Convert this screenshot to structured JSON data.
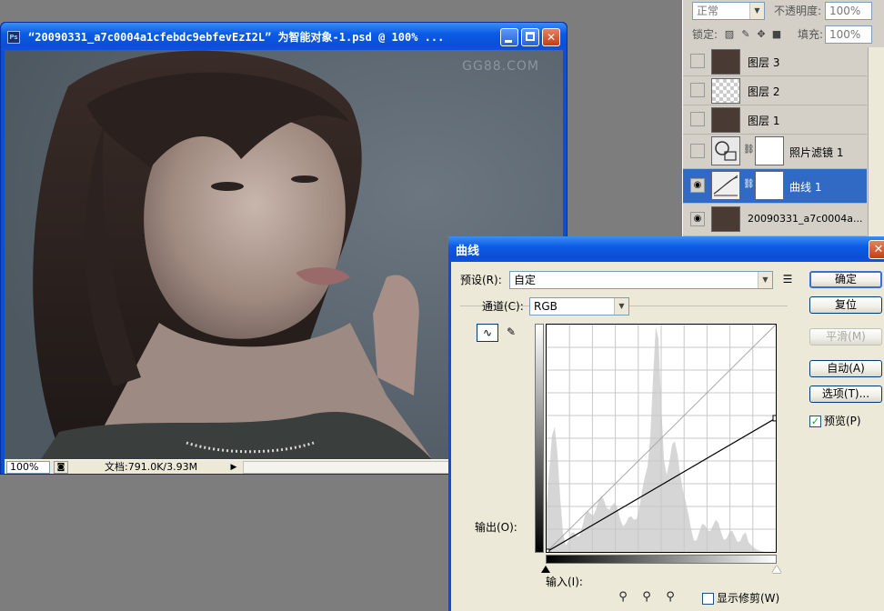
{
  "document": {
    "title": "“20090331_a7c0004a1cfebdc9ebfevEzI2L” 为智能对象-1.psd @ 100% ...",
    "app_icon": "Ps",
    "minimize_icon": "minimize-icon",
    "maximize_icon": "maximize-icon",
    "close_glyph": "✕",
    "watermark": "GG88.COM",
    "zoom": "100%",
    "doc_info": "文档:791.0K/3.93M",
    "status_menu_glyph": "◙",
    "status_arrow_glyph": "▶"
  },
  "layers_panel": {
    "blend_mode": "正常",
    "opacity_label": "不透明度:",
    "opacity_value": "100%",
    "lock_label": "锁定:",
    "fill_label": "填充:",
    "fill_value": "100%",
    "layers": [
      {
        "name": "图层 3",
        "visible": false,
        "selected": false
      },
      {
        "name": "图层 2",
        "visible": false,
        "selected": false
      },
      {
        "name": "图层 1",
        "visible": false,
        "selected": false
      },
      {
        "name": "照片滤镜 1",
        "visible": false,
        "selected": false
      },
      {
        "name": "曲线 1",
        "visible": true,
        "selected": true
      },
      {
        "name": "20090331_a7c0004a...",
        "visible": true,
        "selected": false
      }
    ]
  },
  "curves_dialog": {
    "title": "曲线",
    "close_glyph": "✕",
    "preset_label": "预设(R):",
    "preset_value": "自定",
    "channel_label": "通道(C):",
    "channel_value": "RGB",
    "output_label": "输出(O):",
    "input_label": "输入(I):",
    "buttons": {
      "ok": "确定",
      "reset": "复位",
      "smooth": "平滑(M)",
      "auto": "自动(A)",
      "options": "选项(T)..."
    },
    "preview_label": "预览(P)",
    "preview_checked": true,
    "show_clipping_label": "显示修剪(W)",
    "show_clipping_checked": false,
    "curve_points": [
      [
        0,
        0
      ],
      [
        255,
        150
      ]
    ],
    "histogram_color": "#d6d6d6"
  },
  "colors": {
    "xp_blue": "#0a4fd6",
    "selection": "#316ac5",
    "dialog_bg": "#ece9d8",
    "panel_bg": "#d4d0c8"
  }
}
